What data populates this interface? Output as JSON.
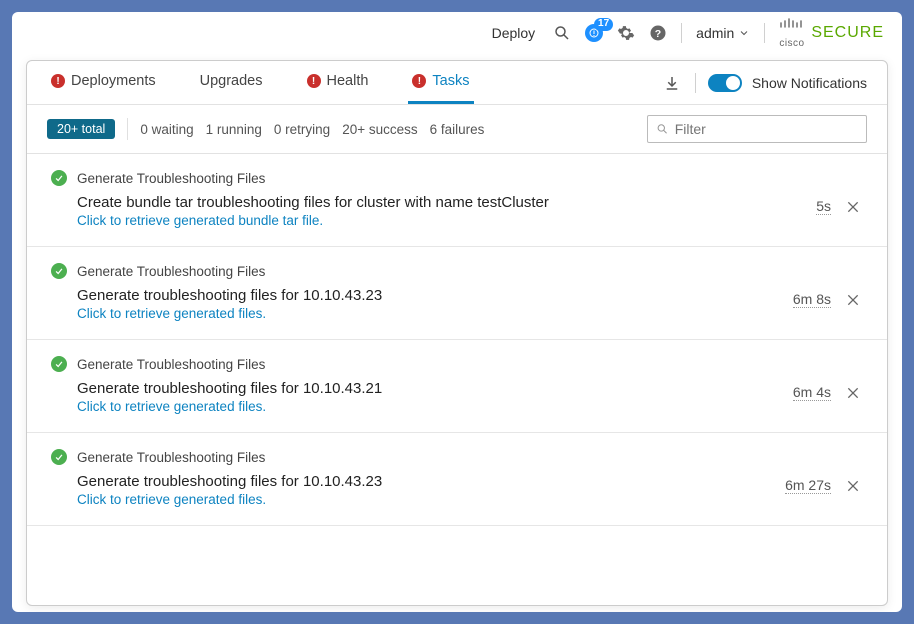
{
  "appbar": {
    "deploy": "Deploy",
    "notif_count": "17",
    "user": "admin",
    "brand_top": "cisco",
    "brand_main": "SECURE"
  },
  "tabs": {
    "deployments": "Deployments",
    "upgrades": "Upgrades",
    "health": "Health",
    "tasks": "Tasks",
    "show_notifications": "Show Notifications"
  },
  "filterbar": {
    "total": "20+ total",
    "waiting": "0 waiting",
    "running": "1 running",
    "retrying": "0 retrying",
    "success": "20+ success",
    "failures": "6 failures",
    "placeholder": "Filter"
  },
  "tasks": [
    {
      "title": "Generate Troubleshooting Files",
      "message": "Create bundle tar troubleshooting files for cluster with name testCluster",
      "link": "Click to retrieve generated bundle tar file.",
      "duration": "5s"
    },
    {
      "title": "Generate Troubleshooting Files",
      "message": "Generate troubleshooting files for 10.10.43.23",
      "link": "Click to retrieve generated files.",
      "duration": "6m 8s"
    },
    {
      "title": "Generate Troubleshooting Files",
      "message": "Generate troubleshooting files for 10.10.43.21",
      "link": "Click to retrieve generated files.",
      "duration": "6m 4s"
    },
    {
      "title": "Generate Troubleshooting Files",
      "message": "Generate troubleshooting files for 10.10.43.23",
      "link": "Click to retrieve generated files.",
      "duration": "6m 27s"
    }
  ]
}
